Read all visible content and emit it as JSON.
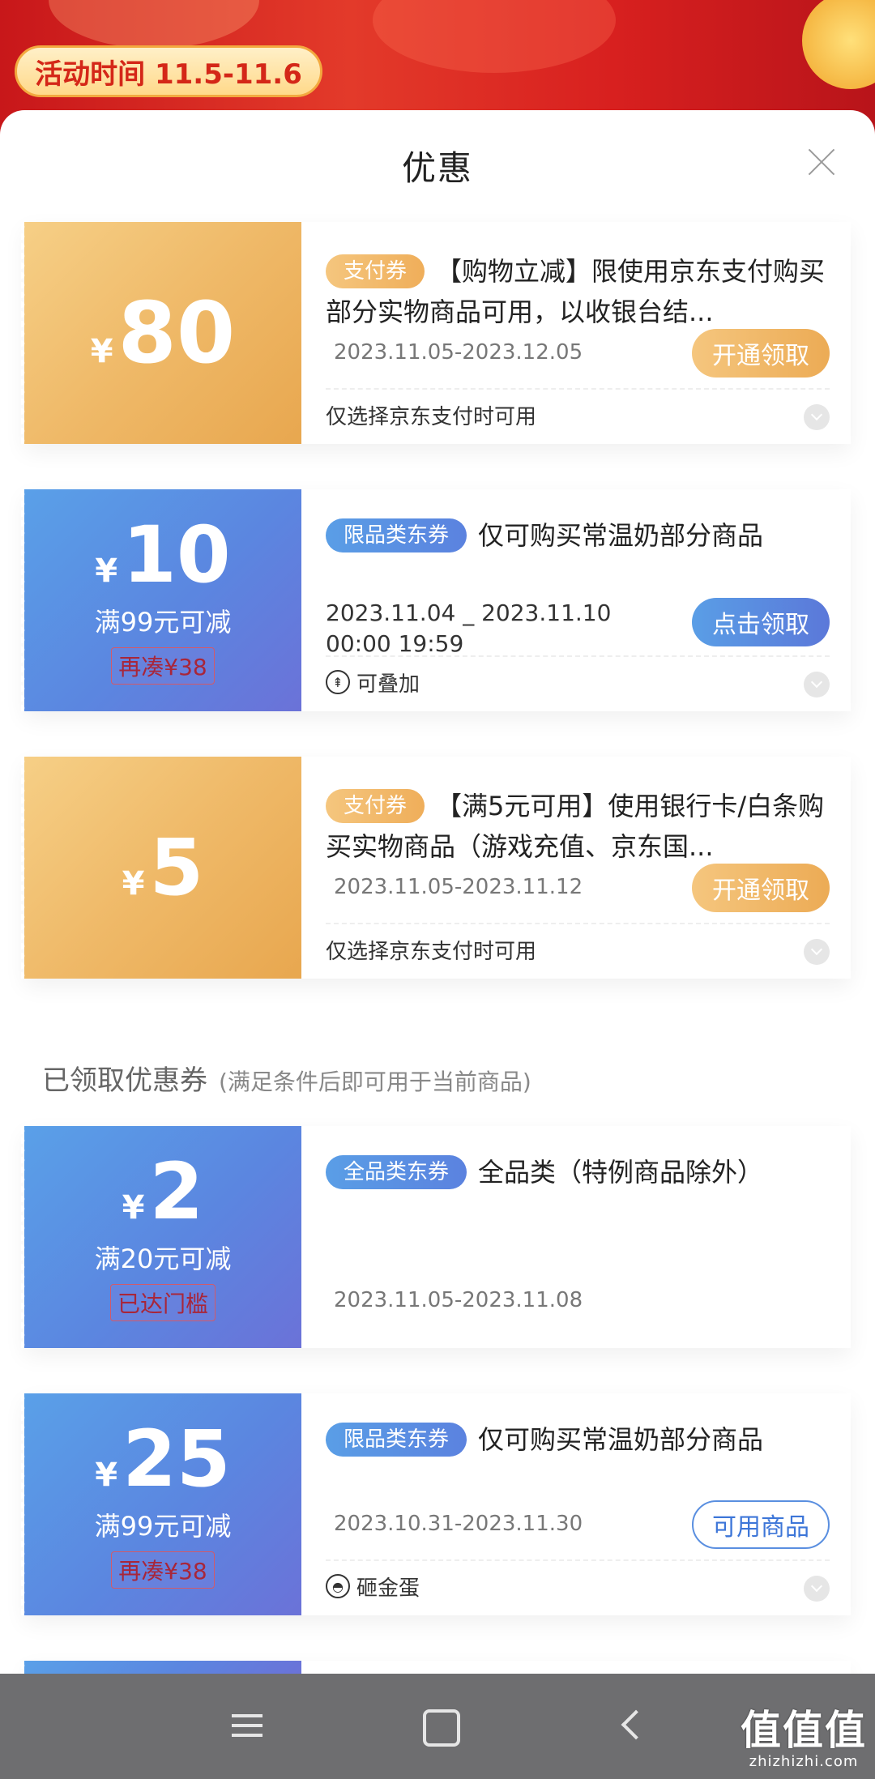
{
  "banner": {
    "activity_text": "活动时间 11.5-11.6"
  },
  "sheet": {
    "title": "优惠"
  },
  "available_coupons": [
    {
      "yen": "¥",
      "amount": "80",
      "badge": "支付券",
      "title": "【购物立减】限使用京东支付购买部分实物商品可用，以收银台结...",
      "date": "2023.11.05-2023.12.05",
      "button": "开通领取",
      "footnote": "仅选择京东支付时可用"
    },
    {
      "yen": "¥",
      "amount": "10",
      "condition": "满99元可减",
      "extra": "再凑¥38",
      "badge": "限品类东券",
      "title": "仅可购买常温奶部分商品",
      "date_line1": "2023.11.04 _ 2023.11.10",
      "date_line2": "00:00 19:59",
      "button": "点击领取",
      "footnote": "可叠加"
    },
    {
      "yen": "¥",
      "amount": "5",
      "badge": "支付券",
      "title": "【满5元可用】使用银行卡/白条购买实物商品（游戏充值、京东国...",
      "date": "2023.11.05-2023.11.12",
      "button": "开通领取",
      "footnote": "仅选择京东支付时可用"
    }
  ],
  "received_section": {
    "title": "已领取优惠券",
    "subtitle": "(满足条件后即可用于当前商品)"
  },
  "received_coupons": [
    {
      "yen": "¥",
      "amount": "2",
      "condition": "满20元可减",
      "extra": "已达门槛",
      "badge": "全品类东券",
      "title": "全品类（特例商品除外）",
      "date": "2023.11.05-2023.11.08"
    },
    {
      "yen": "¥",
      "amount": "25",
      "condition": "满99元可减",
      "extra": "再凑¥38",
      "badge": "限品类东券",
      "title": "仅可购买常温奶部分商品",
      "date": "2023.10.31-2023.11.30",
      "button": "可用商品",
      "footnote": "砸金蛋"
    }
  ],
  "watermark": {
    "main": "值值值",
    "sub": "zhizhizhi.com"
  },
  "colors": {
    "gold": "#efb968",
    "blue": "#5b86e0",
    "nav": "#6e6e70"
  }
}
